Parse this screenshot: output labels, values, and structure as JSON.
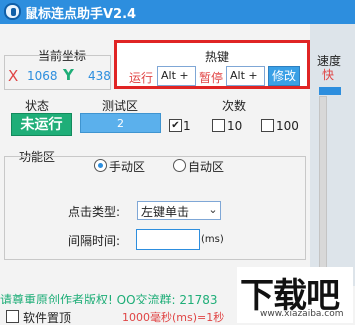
{
  "window": {
    "title": "鼠标连点助手V2.4"
  },
  "coords": {
    "title": "当前坐标",
    "x_label": "X",
    "x_value": "1068",
    "y_label": "Y",
    "y_value": "438"
  },
  "hotkey": {
    "title": "热键",
    "run_label": "运行",
    "run_value": "Alt +",
    "pause_label": "暂停",
    "pause_value": "Alt +",
    "modify_label": "修改"
  },
  "speed": {
    "title": "速度",
    "value_label": "快",
    "level": 1.0
  },
  "status": {
    "title": "状态",
    "value": "未运行"
  },
  "test_area": {
    "title": "测试区",
    "value": "2"
  },
  "count": {
    "title": "次数",
    "options": [
      {
        "label": "1",
        "checked": true
      },
      {
        "label": "10",
        "checked": false
      },
      {
        "label": "100",
        "checked": false
      }
    ]
  },
  "function_area": {
    "title": "功能区",
    "mode_manual": "手动区",
    "mode_auto": "自动区",
    "selected_mode": "手动区",
    "click_type_label": "点击类型:",
    "click_type_value": "左键单击",
    "interval_label": "间隔时间:",
    "interval_value": "",
    "interval_unit": "(ms)"
  },
  "footer": {
    "marquee": "请尊重原创作者版权! QQ交流群: 21783",
    "topmost_label": "软件置顶",
    "hint": "1000毫秒(ms)=1秒"
  },
  "watermark": {
    "main": "下载吧",
    "sub": "www.xiazaiba.com"
  },
  "colors": {
    "titlebar": "#2d8ede",
    "status_bg": "#1fae78",
    "hotkey_highlight": "#e02424"
  }
}
